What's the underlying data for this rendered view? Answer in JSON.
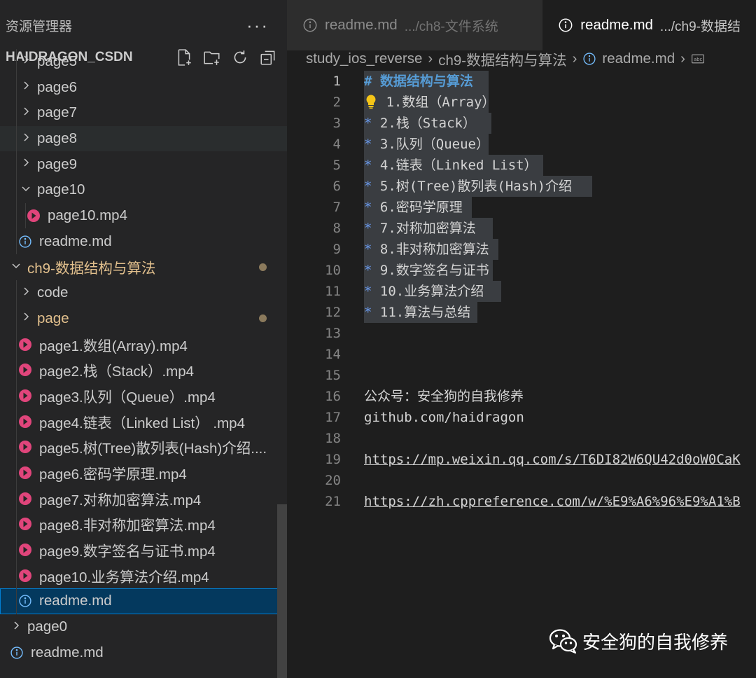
{
  "explorer": {
    "title": "资源管理器",
    "more": "···",
    "workspace": "HAIDRAGON_CSDN",
    "items": [
      {
        "label": "page5",
        "type": "folder",
        "depth": 1,
        "expanded": false
      },
      {
        "label": "page6",
        "type": "folder",
        "depth": 1,
        "expanded": false
      },
      {
        "label": "page7",
        "type": "folder",
        "depth": 1,
        "expanded": false
      },
      {
        "label": "page8",
        "type": "folder",
        "depth": 1,
        "expanded": false,
        "hover": true
      },
      {
        "label": "page9",
        "type": "folder",
        "depth": 1,
        "expanded": false
      },
      {
        "label": "page10",
        "type": "folder",
        "depth": 1,
        "expanded": true
      },
      {
        "label": "page10.mp4",
        "type": "video",
        "depth": 2
      },
      {
        "label": "readme.md",
        "type": "info",
        "depth": 1
      },
      {
        "label": "ch9-数据结构与算法",
        "type": "folder",
        "depth": 0,
        "expanded": true,
        "modified": true
      },
      {
        "label": "code",
        "type": "folder",
        "depth": 1,
        "expanded": false
      },
      {
        "label": "page",
        "type": "folder",
        "depth": 1,
        "expanded": false,
        "modified": true
      },
      {
        "label": "page1.数组(Array).mp4",
        "type": "video",
        "depth": 1
      },
      {
        "label": "page2.栈（Stack）.mp4",
        "type": "video",
        "depth": 1
      },
      {
        "label": "page3.队列（Queue）.mp4",
        "type": "video",
        "depth": 1
      },
      {
        "label": "page4.链表（Linked List） .mp4",
        "type": "video",
        "depth": 1
      },
      {
        "label": "page5.树(Tree)散列表(Hash)介绍....",
        "type": "video",
        "depth": 1
      },
      {
        "label": "page6.密码学原理.mp4",
        "type": "video",
        "depth": 1
      },
      {
        "label": "page7.对称加密算法.mp4",
        "type": "video",
        "depth": 1
      },
      {
        "label": "page8.非对称加密算法.mp4",
        "type": "video",
        "depth": 1
      },
      {
        "label": "page9.数字签名与证书.mp4",
        "type": "video",
        "depth": 1
      },
      {
        "label": "page10.业务算法介绍.mp4",
        "type": "video",
        "depth": 1
      },
      {
        "label": "readme.md",
        "type": "info",
        "depth": 1,
        "selected": true
      },
      {
        "label": "page0",
        "type": "folder",
        "depth": 0,
        "expanded": false
      },
      {
        "label": "readme.md",
        "type": "info",
        "depth": 0
      }
    ]
  },
  "tabs": [
    {
      "label": "readme.md",
      "desc": ".../ch8-文件系统",
      "active": false
    },
    {
      "label": "readme.md",
      "desc": ".../ch9-数据结",
      "active": true
    }
  ],
  "breadcrumb": {
    "items": [
      "study_ios_reverse",
      "ch9-数据结构与算法",
      "readme.md"
    ]
  },
  "editor": {
    "lines": [
      {
        "n": "1",
        "marker": "#",
        "text": "数据结构与算法",
        "kind": "heading",
        "sel": true
      },
      {
        "n": "2",
        "marker": "bulb",
        "text": "1.数组（Array）",
        "kind": "bullet",
        "sel": true
      },
      {
        "n": "3",
        "marker": "*",
        "text": "2.栈（Stack）",
        "kind": "bullet",
        "sel": true
      },
      {
        "n": "4",
        "marker": "*",
        "text": "3.队列（Queue）",
        "kind": "bullet",
        "sel": true
      },
      {
        "n": "5",
        "marker": "*",
        "text": "4.链表（Linked List）",
        "kind": "bullet",
        "sel": true
      },
      {
        "n": "6",
        "marker": "*",
        "text": "5.树(Tree)散列表(Hash)介绍",
        "kind": "bullet",
        "sel": true
      },
      {
        "n": "7",
        "marker": "*",
        "text": "6.密码学原理",
        "kind": "bullet",
        "sel": true
      },
      {
        "n": "8",
        "marker": "*",
        "text": "7.对称加密算法",
        "kind": "bullet",
        "sel": true
      },
      {
        "n": "9",
        "marker": "*",
        "text": "8.非对称加密算法",
        "kind": "bullet",
        "sel": true
      },
      {
        "n": "10",
        "marker": "*",
        "text": "9.数字签名与证书",
        "kind": "bullet",
        "sel": true
      },
      {
        "n": "11",
        "marker": "*",
        "text": "10.业务算法介绍",
        "kind": "bullet",
        "sel": true
      },
      {
        "n": "12",
        "marker": "*",
        "text": "11.算法与总结",
        "kind": "bullet",
        "sel": true
      },
      {
        "n": "13",
        "text": "",
        "kind": "plain"
      },
      {
        "n": "14",
        "text": "",
        "kind": "plain"
      },
      {
        "n": "15",
        "text": "",
        "kind": "plain"
      },
      {
        "n": "16",
        "text": "公众号：安全狗的自我修养",
        "kind": "plain"
      },
      {
        "n": "17",
        "text": "github.com/haidragon",
        "kind": "plain"
      },
      {
        "n": "18",
        "text": "",
        "kind": "plain"
      },
      {
        "n": "19",
        "text": "https://mp.weixin.qq.com/s/T6DI82W6QU42d0oW0CaK",
        "kind": "link"
      },
      {
        "n": "20",
        "text": "",
        "kind": "plain"
      },
      {
        "n": "21",
        "text": "https://zh.cppreference.com/w/%E9%A6%96%E9%A1%B",
        "kind": "link"
      }
    ]
  },
  "watermark": {
    "text": "安全狗的自我修养"
  },
  "colors": {
    "accent": "#007fd4",
    "video": "#e0457b",
    "info": "#75beff",
    "modified": "#e2c08d"
  }
}
